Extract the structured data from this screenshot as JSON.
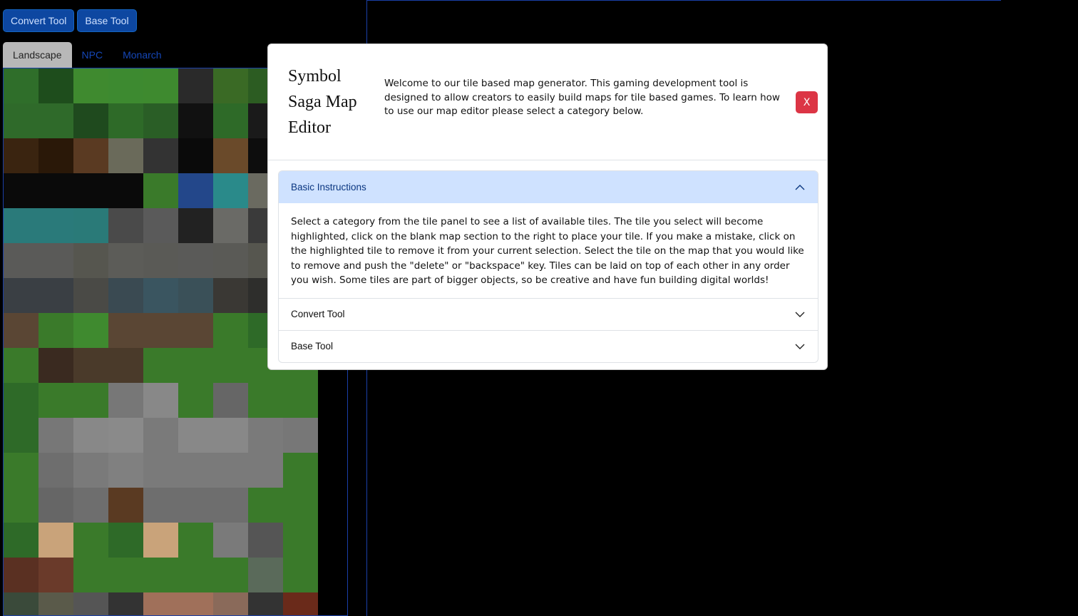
{
  "toolbar": {
    "convert_label": "Convert Tool",
    "base_label": "Base Tool"
  },
  "tabs": [
    {
      "label": "Landscape",
      "active": true
    },
    {
      "label": "NPC",
      "active": false
    },
    {
      "label": "Monarch",
      "active": false
    }
  ],
  "tile_colors": [
    "#2f6e2a",
    "#1e4d1c",
    "#3f8a2f",
    "#3d8a30",
    "#3e8a2f",
    "#2a2a2a",
    "#3a6a25",
    "#2c5c22",
    "#2f7a2a",
    "#2f6a2a",
    "#2f6a2a",
    "#1f4a1e",
    "#2e6a28",
    "#2a5e26",
    "#111111",
    "#2e6a28",
    "#1a1a1a",
    "#3a3a3a",
    "#3a2410",
    "#2a1808",
    "#5a3a22",
    "#6a6a5a",
    "#333333",
    "#0a0a0a",
    "#6a4a2a",
    "#0d0d0d",
    "#101010",
    "#0a0a0a",
    "#0a0a0a",
    "#0a0a0a",
    "#0a0a0a",
    "#3a7a2a",
    "#23478a",
    "#2a8a8a",
    "#6a6a60",
    "#555555",
    "#2a7a7a",
    "#2a7a7a",
    "#2a7a78",
    "#4a4a4a",
    "#5a5a5a",
    "#222222",
    "#6a6a66",
    "#3a3a3a",
    "#5c5c58",
    "#5a5a58",
    "#5a5a58",
    "#56564f",
    "#5c5c58",
    "#5a5a56",
    "#5a5a58",
    "#5a5a56",
    "#56564f",
    "#595955",
    "#3a3f44",
    "#3a3f44",
    "#4a4a46",
    "#3a4a52",
    "#3a5560",
    "#3a5058",
    "#3a3834",
    "#2e2e2c",
    "#3e3e3a",
    "#5a4634",
    "#3a7a2a",
    "#3f8a2f",
    "#5a4634",
    "#5a4634",
    "#5a4634",
    "#3a7a2a",
    "#2e6a28",
    "#3a7a2a",
    "#3a7a2a",
    "#3a2a20",
    "#4a3a2a",
    "#4a3a2a",
    "#3a7a2a",
    "#3a7a2a",
    "#3a7a2a",
    "#3a7a2a",
    "#3a7a2a",
    "#2e6a28",
    "#3a7a2a",
    "#3a7a2a",
    "#777777",
    "#888888",
    "#3a7a2a",
    "#666666",
    "#3a7a2a",
    "#3a7a2a",
    "#2e6a28",
    "#777777",
    "#888888",
    "#8a8a8a",
    "#7a7a7a",
    "#888888",
    "#888888",
    "#7a7a7a",
    "#777777",
    "#3a7a2a",
    "#6e6e6e",
    "#7a7a7a",
    "#808080",
    "#7a7a7a",
    "#7a7a7a",
    "#7a7a7a",
    "#7a7a7a",
    "#3a7a2a",
    "#3a7a2a",
    "#666666",
    "#6e6e6e",
    "#5a3a22",
    "#6e6e6e",
    "#6e6e6e",
    "#6e6e6e",
    "#3a7a2a",
    "#3a7a2a",
    "#2e6a28",
    "#c9a37a",
    "#3a7a2a",
    "#2e6a28",
    "#c9a37a",
    "#3a7a2a",
    "#7a7a7a",
    "#555555",
    "#3a7a2a",
    "#5a3022",
    "#6a3a2a",
    "#3a7a2a",
    "#3a7a2a",
    "#3a7a2a",
    "#3a7a2a",
    "#3a7a2a",
    "#5a6a5a",
    "#3a7a2a",
    "#3a4a3a",
    "#5a5a4a",
    "#555555",
    "#333333",
    "#a0705a",
    "#a0705a",
    "#8a6a5a",
    "#333333",
    "#6a2a1a"
  ],
  "modal": {
    "title": "Symbol Saga Map Editor",
    "intro": "Welcome to our tile based map generator. This gaming development tool is designed to allow creators to easily build maps for tile based games. To learn how to use our map editor please select a category below.",
    "close_label": "X"
  },
  "accordion": {
    "items": [
      {
        "title": "Basic Instructions",
        "expanded": true,
        "body": "Select a category from the tile panel to see a list of available tiles. The tile you select will become highlighted, click on the blank map section to the right to place your tile. If you make a mistake, click on the highlighted tile to remove it from your current selection. Select the tile on the map that you would like to remove and push the \"delete\" or \"backspace\" key. Tiles can be laid on top of each other in any order you wish. Some tiles are part of bigger objects, so be creative and have fun building digital worlds!"
      },
      {
        "title": "Convert Tool",
        "expanded": false,
        "body": ""
      },
      {
        "title": "Base Tool",
        "expanded": false,
        "body": ""
      }
    ]
  }
}
